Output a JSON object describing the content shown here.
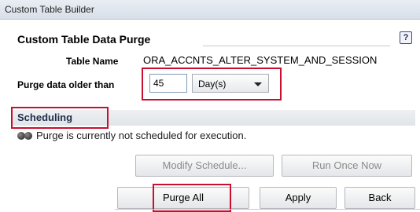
{
  "window": {
    "title": "Custom Table Builder"
  },
  "section": {
    "title": "Custom Table Data Purge",
    "help_icon": "question-mark-icon"
  },
  "table": {
    "label": "Table Name",
    "value": "ORA_ACCNTS_ALTER_SYSTEM_AND_SESSION"
  },
  "purge": {
    "label": "Purge data older than",
    "value": "45",
    "unit_selected": "Day(s)"
  },
  "scheduling": {
    "header": "Scheduling",
    "status": "Purge is currently not scheduled for execution.",
    "modify_label": "Modify Schedule...",
    "run_once_label": "Run Once Now"
  },
  "actions": {
    "purge_all_label": "Purge All",
    "apply_label": "Apply",
    "back_label": "Back"
  },
  "colors": {
    "highlight": "#c8102e"
  }
}
